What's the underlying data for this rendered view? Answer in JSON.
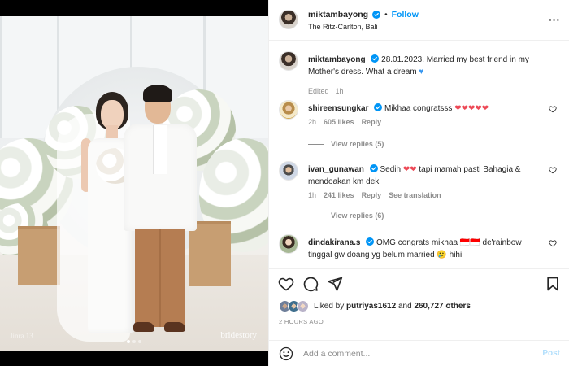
{
  "post": {
    "author": "miktambayong",
    "follow_label": "Follow",
    "separator": "•",
    "location": "The Ritz-Carlton, Bali",
    "caption": {
      "text": "28.01.2023. Married my best friend in my Mother's dress. What a dream",
      "meta": "Edited · 1h"
    },
    "photo": {
      "watermark_left": "Jinra 13",
      "watermark_right": "bridestory",
      "carousel_dots": 3,
      "active_dot": 0
    }
  },
  "comments": [
    {
      "username": "shireensungkar",
      "verified": true,
      "text": "Mikhaa congratsss",
      "hearts": "❤❤❤❤❤",
      "age": "2h",
      "likes": "605 likes",
      "reply_label": "Reply",
      "view_replies": "View replies (5)"
    },
    {
      "username": "ivan_gunawan",
      "verified": true,
      "text_before": "Sedih",
      "hearts": "❤❤",
      "text_after": "tapi mamah pasti Bahagia & mendoakan km dek",
      "age": "1h",
      "likes": "241 likes",
      "reply_label": "Reply",
      "translation_label": "See translation",
      "view_replies": "View replies (6)"
    },
    {
      "username": "dindakirana.s",
      "verified": true,
      "text": "OMG congrats mikhaa 🇮🇩🇮🇩 de'rainbow tinggal gw doang yg belum married 🥲 hihi",
      "age": "",
      "likes": ""
    }
  ],
  "actions": {
    "liked_by_prefix": "Liked by",
    "liked_by_user": "putriyas1612",
    "liked_by_mid": "and",
    "liked_by_others": "260,727 others",
    "time_ago": "2 HOURS AGO"
  },
  "composer": {
    "placeholder": "Add a comment...",
    "post_label": "Post"
  },
  "icons": [
    "verified-badge-icon",
    "more-options-icon",
    "heart-icon",
    "comment-icon",
    "share-icon",
    "bookmark-icon",
    "emoji-icon"
  ],
  "colors": {
    "accent": "#0095f6",
    "heart": "#ed4956",
    "muted": "#8e8e8e",
    "post_disabled": "#b2dffc"
  }
}
